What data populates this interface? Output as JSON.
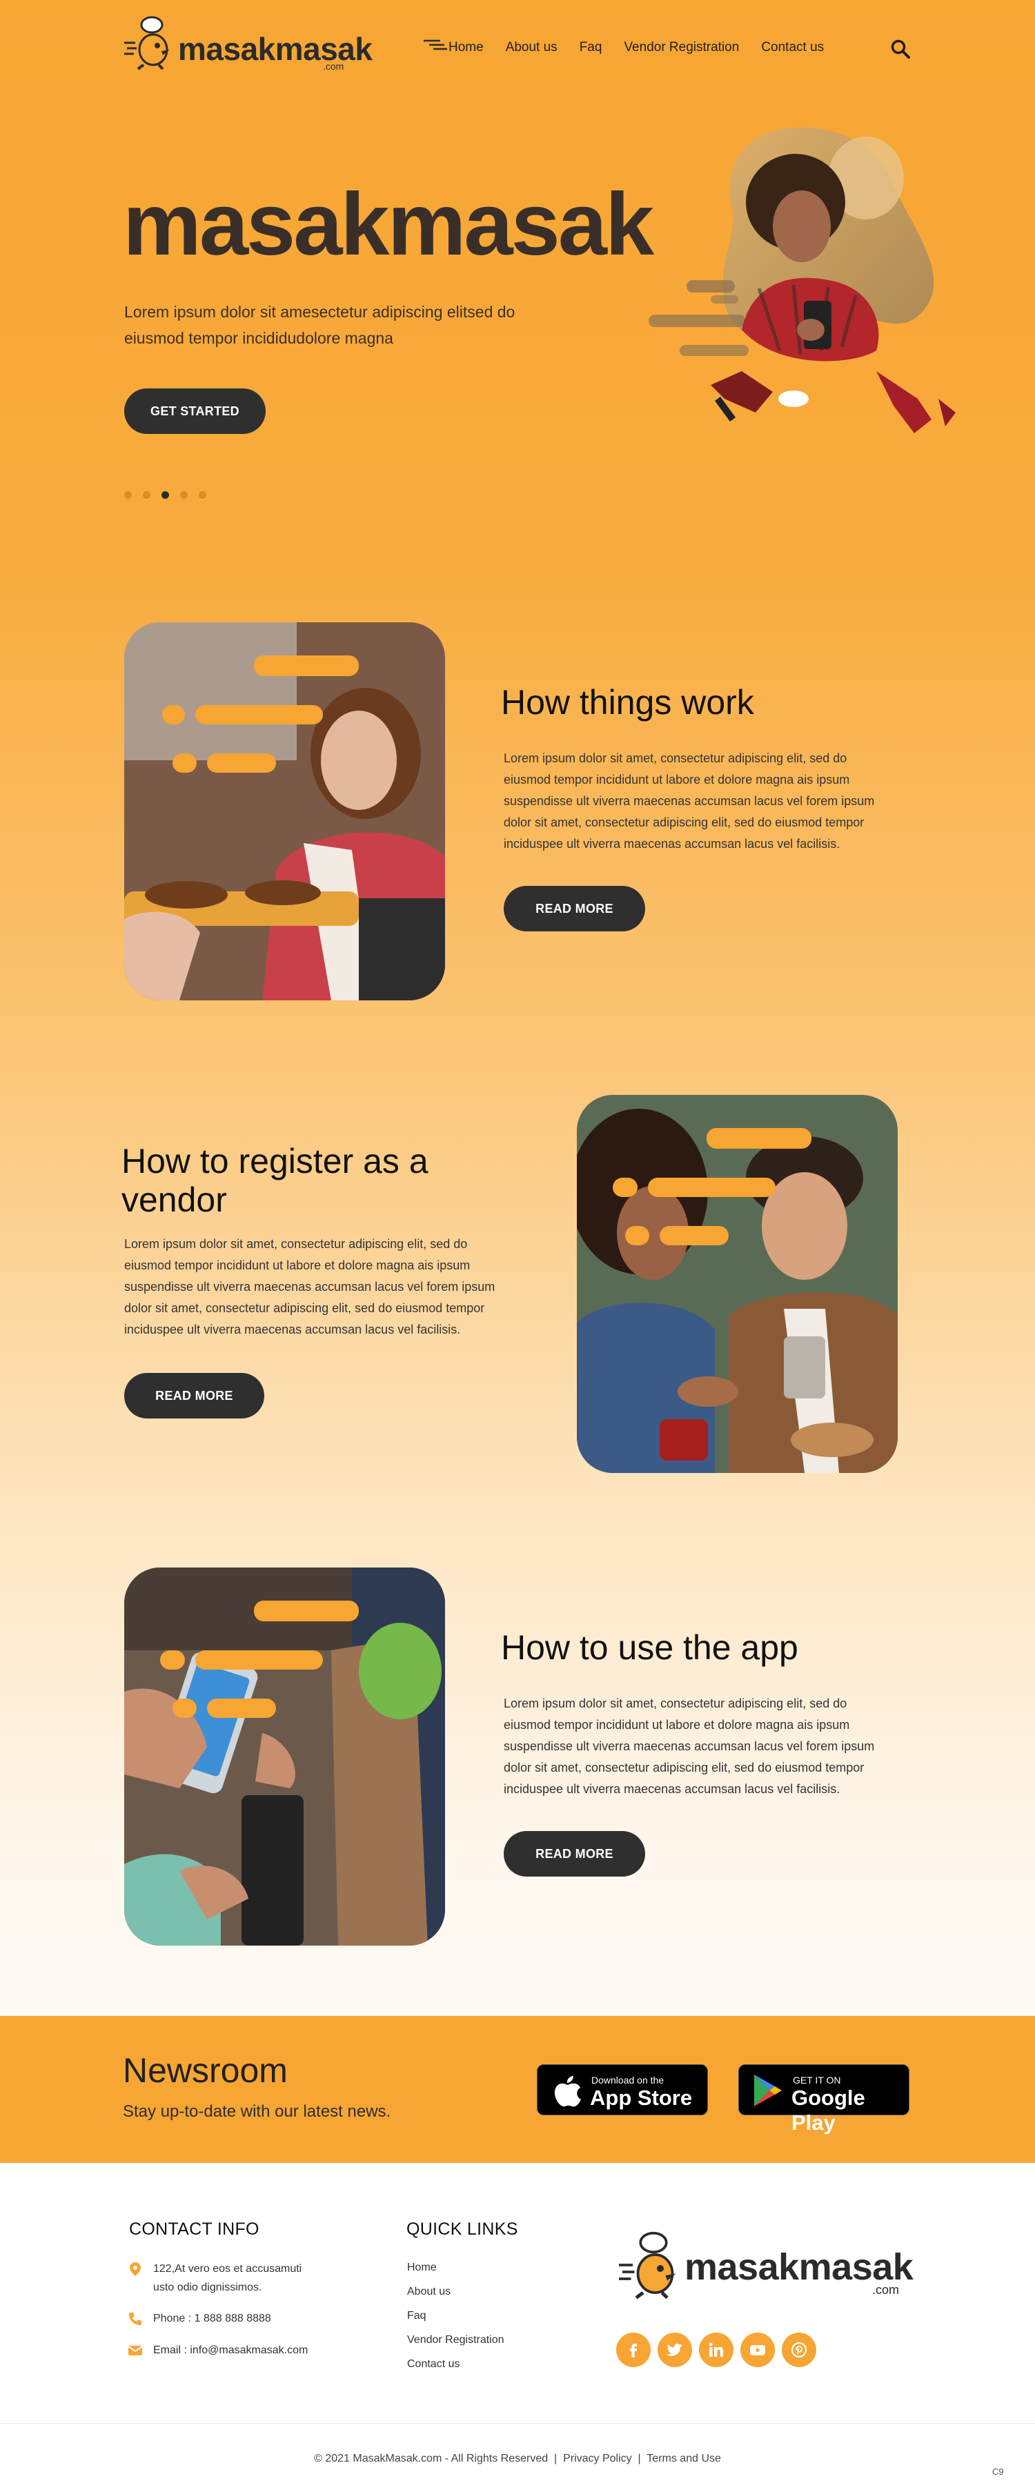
{
  "header": {
    "logo_text": "masakmasak",
    "logo_suffix": ".com",
    "nav": [
      "Home",
      "About us",
      "Faq",
      "Vendor Registration",
      "Contact us"
    ]
  },
  "hero": {
    "title": "masakmasak",
    "subtitle": "Lorem ipsum dolor sit amesectetur adipiscing elitsed do eiusmod tempor incididudolore magna",
    "cta": "GET STARTED",
    "slides_total": 5,
    "slide_active": 3
  },
  "features": [
    {
      "title": "How things work",
      "text": "Lorem ipsum dolor sit amet, consectetur adipiscing elit, sed do eiusmod tempor incididunt ut labore et dolore magna ais ipsum suspendisse ult viverra maecenas accumsan lacus vel forem ipsum dolor sit amet, consectetur adipiscing elit, sed do eiusmod tempor inciduspee ult viverra maecenas accumsan lacus vel facilisis.",
      "button": "READ MORE"
    },
    {
      "title": "How to register as a vendor",
      "text": "Lorem ipsum dolor sit amet, consectetur adipiscing elit, sed do eiusmod tempor incididunt ut labore et dolore magna ais ipsum suspendisse ult viverra maecenas accumsan lacus vel forem ipsum dolor sit amet, consectetur adipiscing elit, sed do eiusmod tempor inciduspee ult viverra maecenas accumsan lacus vel facilisis.",
      "button": "READ MORE"
    },
    {
      "title": "How to use the app",
      "text": "Lorem ipsum dolor sit amet, consectetur adipiscing elit, sed do eiusmod tempor incididunt ut labore et dolore magna ais ipsum suspendisse ult viverra maecenas accumsan lacus vel forem ipsum dolor sit amet, consectetur adipiscing elit, sed do eiusmod tempor inciduspee ult viverra maecenas accumsan lacus vel facilisis.",
      "button": "READ MORE"
    }
  ],
  "newsroom": {
    "title": "Newsroom",
    "subtitle": "Stay up-to-date with our latest news.",
    "app_store": {
      "small": "Download on the",
      "big": "App Store"
    },
    "google_play": {
      "small": "GET IT ON",
      "big": "Google Play"
    }
  },
  "footer": {
    "contact_title": "CONTACT INFO",
    "address": "122,At vero eos et accusamuti usto odio dignissimos.",
    "phone": "Phone :  1 888 888 8888",
    "email": "Email : info@masakmasak.com",
    "links_title": "QUICK LINKS",
    "links": [
      "Home",
      "About us",
      "Faq",
      "Vendor Registration",
      "Contact us"
    ],
    "logo_text": "masakmasak",
    "logo_suffix": ".com",
    "social": [
      "facebook-icon",
      "twitter-icon",
      "linkedin-icon",
      "youtube-icon",
      "pinterest-icon"
    ],
    "copyright": "© 2021 MasakMasak.com - All Rights Reserved",
    "privacy": "Privacy Policy",
    "terms": "Terms and Use",
    "separator": "|",
    "corner_mark": "C9"
  },
  "colors": {
    "brand_orange": "#f7a533",
    "dark_button": "#2f2f2f",
    "text_dark": "#222222"
  }
}
